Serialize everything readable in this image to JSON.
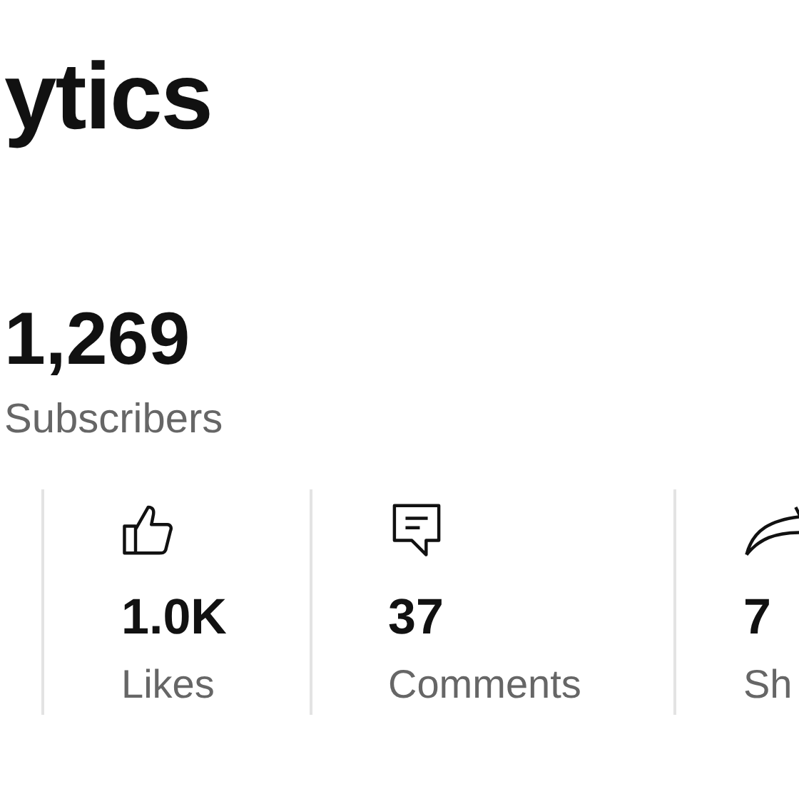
{
  "title": "ytics",
  "subscribers": {
    "value": "1,269",
    "label": "Subscribers"
  },
  "stats": [
    {
      "kind": "likes",
      "value": "1.0K",
      "label": "Likes"
    },
    {
      "kind": "comments",
      "value": "37",
      "label": "Comments"
    },
    {
      "kind": "shares",
      "value": "7",
      "label": "Sh"
    }
  ]
}
